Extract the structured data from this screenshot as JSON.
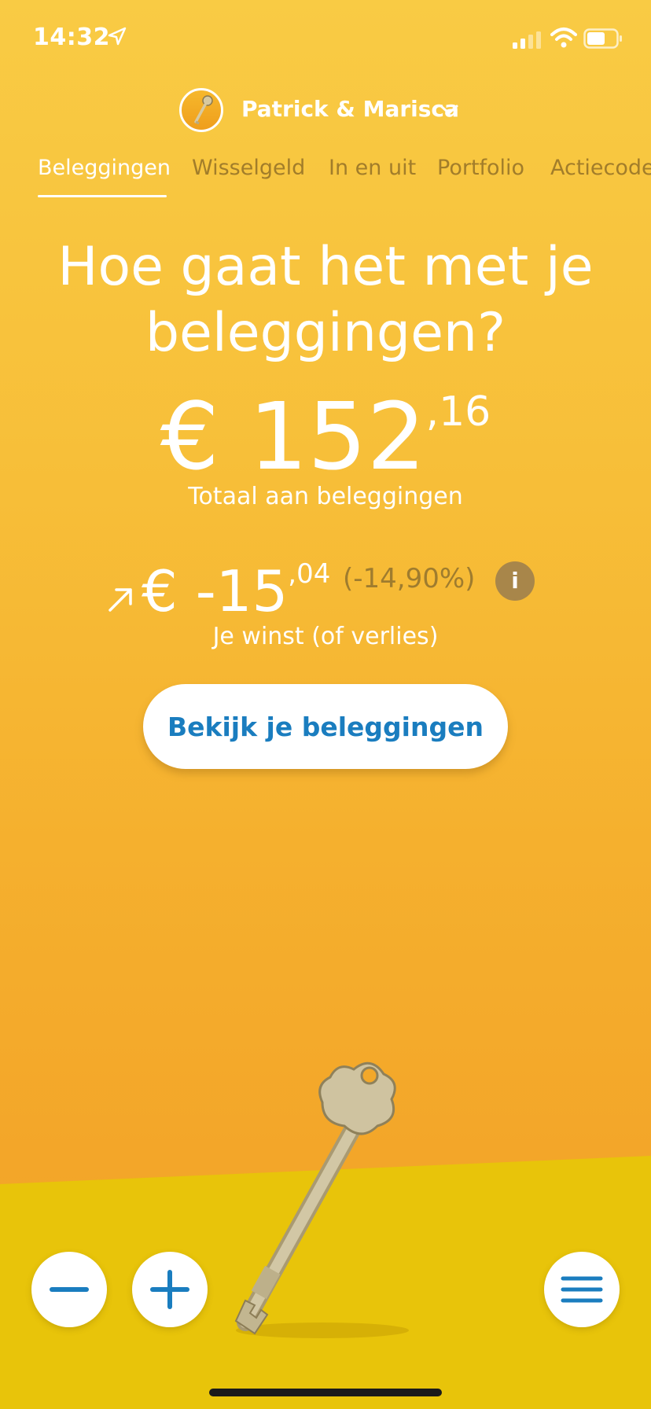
{
  "status_bar": {
    "time": "14:32",
    "icons": [
      "location-arrow-icon",
      "signal-icon",
      "wifi-icon",
      "battery-icon"
    ]
  },
  "account": {
    "name": "Patrick & Marisca",
    "avatar_icon": "key-icon",
    "dropdown_icon": "chevron-down-icon"
  },
  "tabs": [
    {
      "label": "Beleggingen",
      "active": true
    },
    {
      "label": "Wisselgeld",
      "active": false
    },
    {
      "label": "In en uit",
      "active": false
    },
    {
      "label": "Portfolio",
      "active": false
    },
    {
      "label": "Actiecode",
      "active": false
    }
  ],
  "main": {
    "headline_line1": "Hoe gaat het met je",
    "headline_line2": "beleggingen?",
    "total": {
      "currency": "€",
      "whole": "152",
      "sep": ",",
      "cents": "16"
    },
    "total_label": "Totaal aan beleggingen",
    "gain": {
      "whole": "€ -15",
      "sep": ",",
      "cents": "04",
      "percent": "(-14,90%)"
    },
    "info_label": "i",
    "gain_label": "Je winst (of verlies)",
    "cta_label": "Bekijk je beleggingen"
  },
  "bottom_bar": {
    "left_buttons": [
      "minus-icon",
      "plus-icon"
    ],
    "right_button": "menu-icon"
  },
  "colors": {
    "background_top": "#f9cb44",
    "background_bottom": "#f0a226",
    "floor": "#e8c40a",
    "accent_blue": "#1a7dbf",
    "muted_text": "#a27d2a"
  }
}
